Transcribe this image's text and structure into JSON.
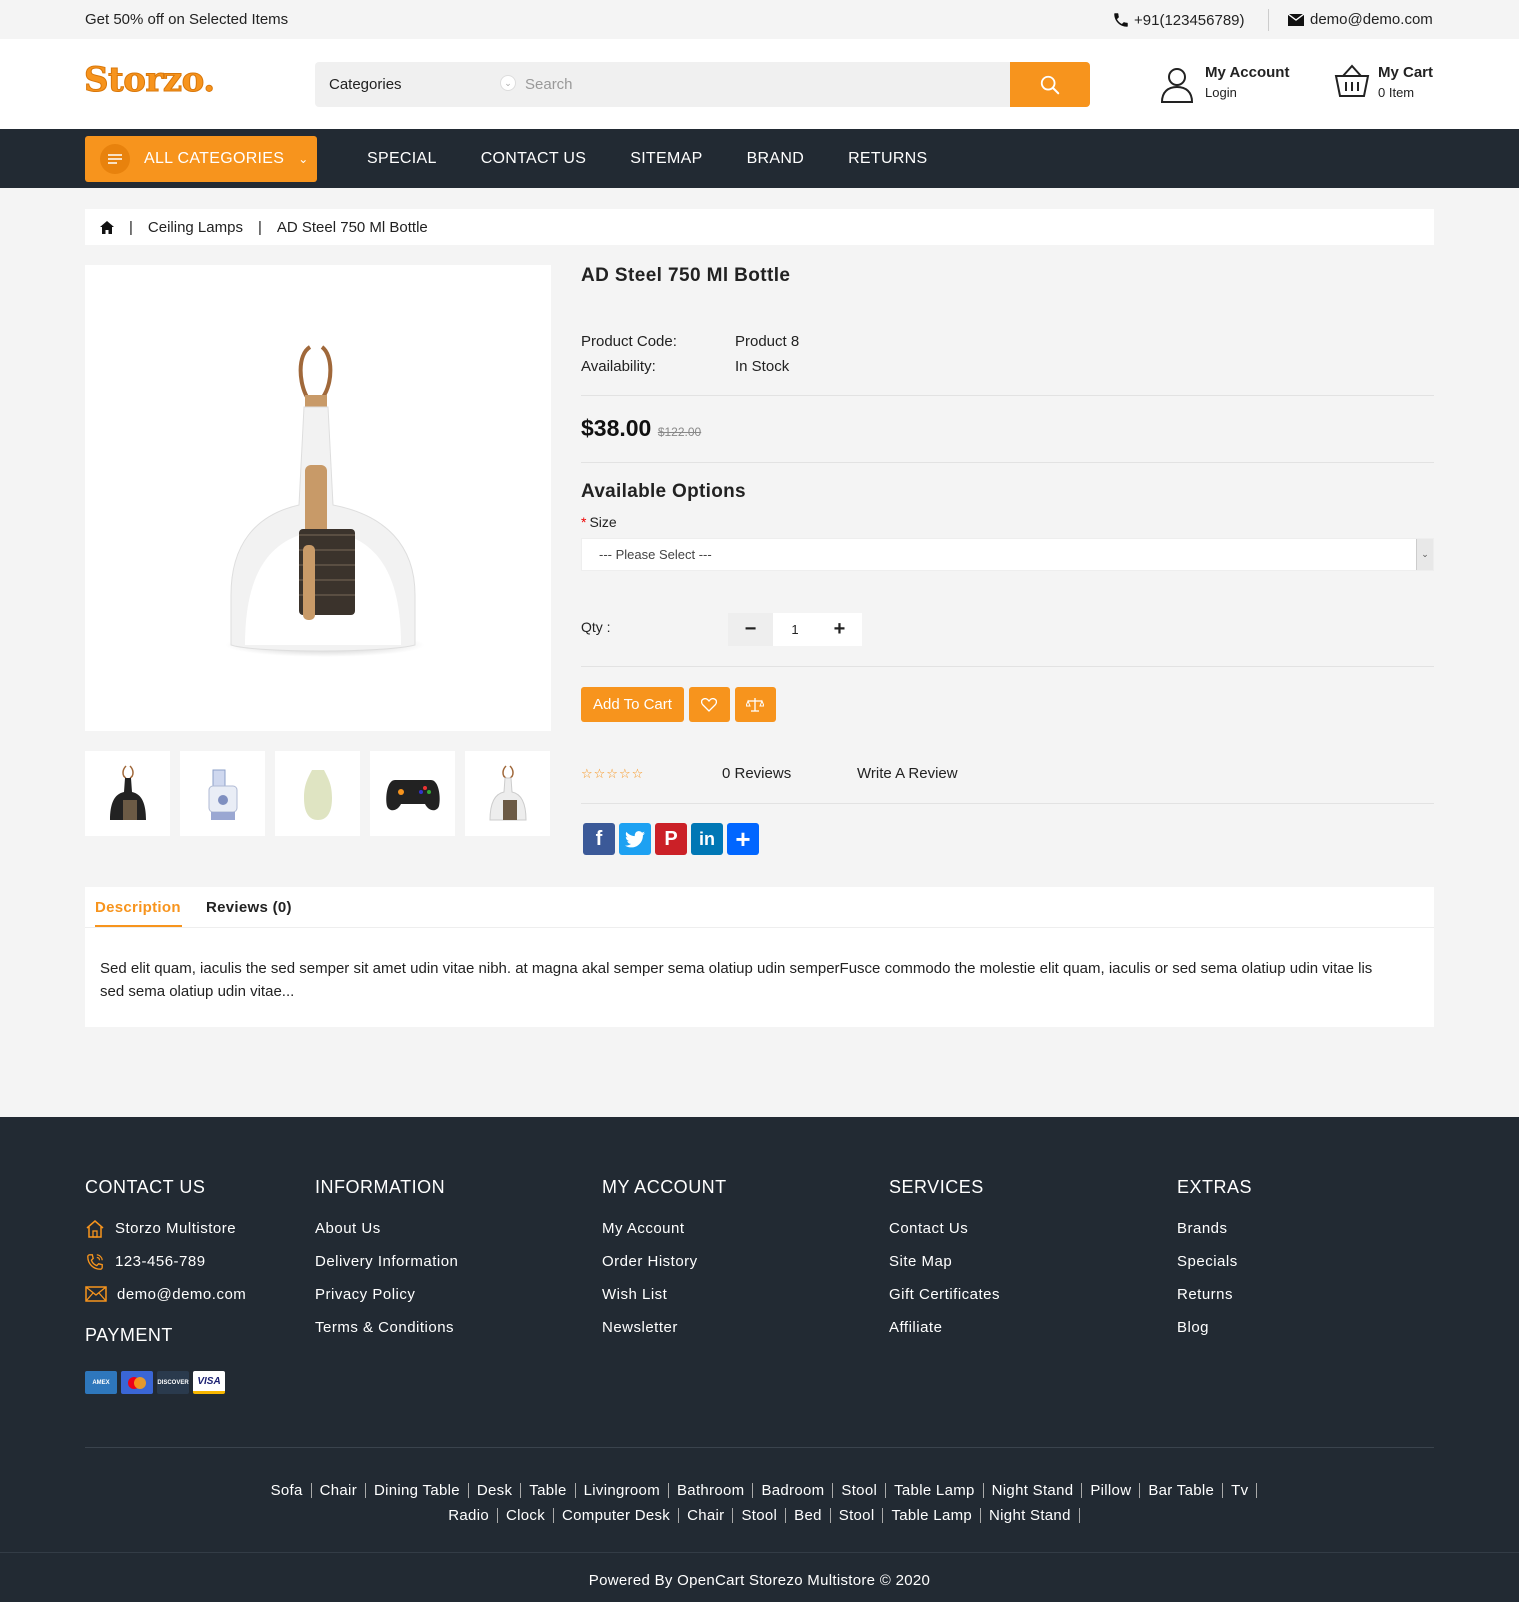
{
  "topbar": {
    "promo": "Get 50% off on Selected Items",
    "phone": "+91(123456789)",
    "email": "demo@demo.com"
  },
  "header": {
    "logo": "Storzo.",
    "category_label": "Categories",
    "search_placeholder": "Search",
    "account_title": "My Account",
    "account_sub": "Login",
    "cart_title": "My Cart",
    "cart_sub": "0 Item"
  },
  "nav": {
    "all_categories": "ALL CATEGORIES",
    "links": [
      "SPECIAL",
      "CONTACT US",
      "SITEMAP",
      "BRAND",
      "RETURNS"
    ]
  },
  "breadcrumb": [
    "Ceiling Lamps",
    "AD Steel 750 Ml Bottle"
  ],
  "product": {
    "title": "AD Steel 750 Ml Bottle",
    "code_label": "Product Code:",
    "code_value": "Product 8",
    "availability_label": "Availability:",
    "availability_value": "In Stock",
    "price": "$38.00",
    "old_price": "$122.00",
    "options_title": "Available Options",
    "size_label": "Size",
    "size_placeholder": "--- Please Select ---",
    "qty_label": "Qty :",
    "qty_value": "1",
    "add_to_cart": "Add To Cart",
    "rating": 0,
    "reviews_link": "0 Reviews",
    "write_review": "Write A Review"
  },
  "share": [
    "facebook",
    "twitter",
    "pinterest",
    "linkedin",
    "more"
  ],
  "tabs": {
    "description_tab": "Description",
    "reviews_tab": "Reviews (0)",
    "description_text": "Sed elit quam, iaculis the sed semper sit amet udin vitae nibh. at magna akal semper sema olatiup udin semperFusce commodo the molestie elit quam, iaculis or sed sema olatiup udin vitae lis sed sema olatiup udin vitae..."
  },
  "footer": {
    "contact": {
      "title": "CONTACT US",
      "name": "Storzo Multistore",
      "phone": "123-456-789",
      "email": "demo@demo.com"
    },
    "payment_title": "PAYMENT",
    "information": {
      "title": "INFORMATION",
      "items": [
        "About Us",
        "Delivery Information",
        "Privacy Policy",
        "Terms & Conditions"
      ]
    },
    "my_account": {
      "title": "MY ACCOUNT",
      "items": [
        "My Account",
        "Order History",
        "Wish List",
        "Newsletter"
      ]
    },
    "services": {
      "title": "SERVICES",
      "items": [
        "Contact Us",
        "Site Map",
        "Gift Certificates",
        "Affiliate"
      ]
    },
    "extras": {
      "title": "EXTRAS",
      "items": [
        "Brands",
        "Specials",
        "Returns",
        "Blog"
      ]
    },
    "tags": [
      "Sofa",
      "Chair",
      "Dining Table",
      "Desk",
      "Table",
      "Livingroom",
      "Bathroom",
      "Badroom",
      "Stool",
      "Table Lamp",
      "Night Stand",
      "Pillow",
      "Bar Table",
      "Tv",
      "Radio",
      "Clock",
      "Computer Desk",
      "Chair",
      "Stool",
      "Bed",
      "Stool",
      "Table Lamp",
      "Night Stand"
    ],
    "copyright": "Powered By OpenCart Storezo Multistore © 2020"
  },
  "colors": {
    "accent": "#f7941d",
    "dark": "#222a33"
  }
}
